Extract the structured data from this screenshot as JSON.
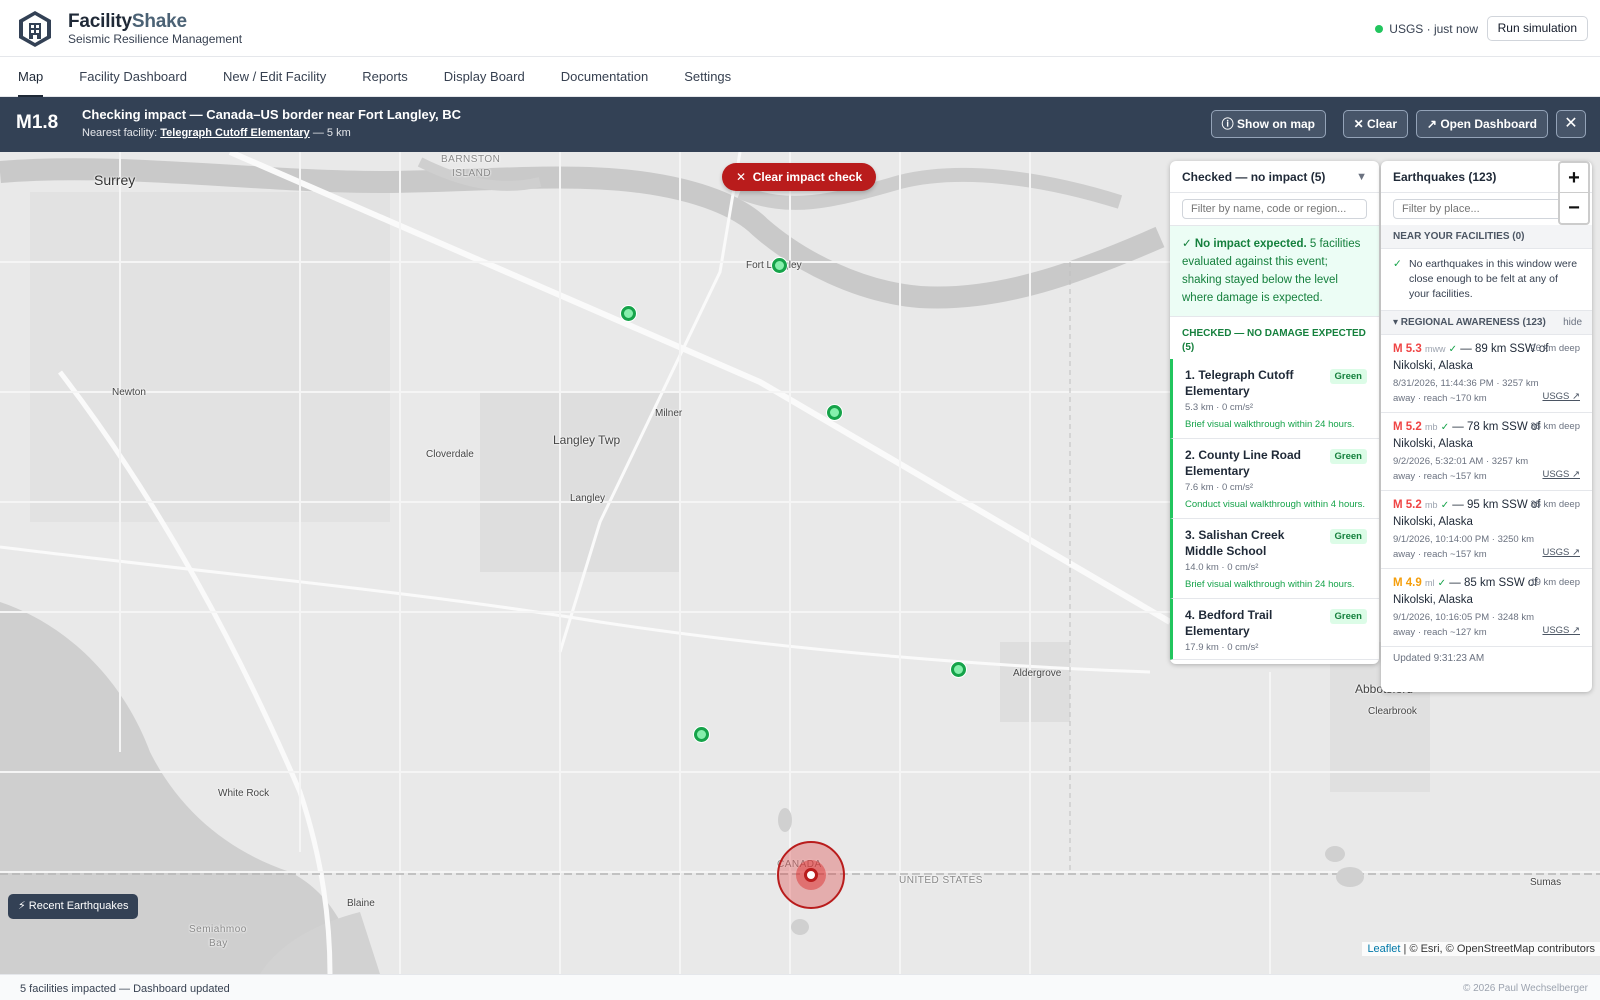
{
  "app": {
    "brand_part1": "Facility",
    "brand_part2": "Shake",
    "tagline": "Seismic Resilience Management",
    "usgs_status": "USGS · just now",
    "run_simulation": "Run simulation"
  },
  "nav": {
    "tabs": [
      "Map",
      "Facility Dashboard",
      "New / Edit Facility",
      "Reports",
      "Display Board",
      "Documentation",
      "Settings"
    ],
    "active": "Map"
  },
  "banner": {
    "magnitude": "M1.8",
    "title": "Checking impact — Canada–US border near Fort Langley, BC",
    "nearest_prefix": "Nearest facility: ",
    "nearest_name": "Telegraph Cutoff Elementary",
    "nearest_suffix": " — 5 km",
    "show_on_map": "Show on map",
    "clear": "Clear",
    "open_dashboard": "Open Dashboard",
    "close": "✕"
  },
  "map": {
    "clear_impact_check": "Clear impact check",
    "recent_earthquakes": "Recent Earthquakes",
    "attribution_leaflet": "Leaflet",
    "attribution_rest": " | © Esri, © OpenStreetMap contributors",
    "places": {
      "surrey": "Surrey",
      "barnston": "BARNSTON",
      "island": "ISLAND",
      "fort_langley": "Fort Langley",
      "newton": "Newton",
      "milner": "Milner",
      "langley_twp": "Langley Twp",
      "cloverdale": "Cloverdale",
      "langley": "Langley",
      "aldergrove": "Aldergrove",
      "abbotsford": "Abbotsford",
      "clearbrook": "Clearbrook",
      "white_rock": "White Rock",
      "blaine": "Blaine",
      "semiahmoo": "Semiahmoo",
      "bay": "Bay",
      "canada": "CANADA",
      "united_states": "UNITED STATES",
      "sumas": "Sumas"
    }
  },
  "facilities_panel": {
    "header": "Checked — no impact (5)",
    "caret": "▼",
    "search_placeholder": "Filter by name, code or region...",
    "no_impact_title": "No impact expected.",
    "no_impact_body": " 5 facilities evaluated against this event; shaking stayed below the level where damage is expected.",
    "checked_header": "CHECKED — NO DAMAGE EXPECTED (5)",
    "items": [
      {
        "name": "1. Telegraph Cutoff Elementary",
        "badge": "Green",
        "meta": "5.3 km · 0 cm/s²",
        "action": "Brief visual walkthrough within 24 hours."
      },
      {
        "name": "2. County Line Road Elementary",
        "badge": "Green",
        "meta": "7.6 km · 0 cm/s²",
        "action": "Conduct visual walkthrough within 4 hours."
      },
      {
        "name": "3. Salishan Creek Middle School",
        "badge": "Green",
        "meta": "14.0 km · 0 cm/s²",
        "action": "Brief visual walkthrough within 24 hours."
      },
      {
        "name": "4. Bedford Trail Elementary",
        "badge": "Green",
        "meta": "17.9 km · 0 cm/s²",
        "action": ""
      }
    ]
  },
  "earthquakes_panel": {
    "header": "Earthquakes (123)",
    "search_placeholder": "Filter by place...",
    "near_header": "NEAR YOUR FACILITIES (0)",
    "near_message": "No earthquakes in this window were close enough to be felt at any of your facilities.",
    "regional_header": "▾  REGIONAL AWARENESS (123)",
    "regional_hide": "hide",
    "items": [
      {
        "mag": "M 5.3",
        "type": "mww",
        "check": "✓",
        "place": "— 89 km SSW of Nikolski, Alaska",
        "depth": "26 km deep",
        "meta": "8/31/2026, 11:44:36 PM · 3257 km away · reach ~170 km",
        "link": "USGS ↗",
        "color": "#ef4444"
      },
      {
        "mag": "M 5.2",
        "type": "mb",
        "check": "✓",
        "place": "— 78 km SSW of Nikolski, Alaska",
        "depth": "35 km deep",
        "meta": "9/2/2026, 5:32:01 AM · 3257 km away · reach ~157 km",
        "link": "USGS ↗",
        "color": "#ef4444"
      },
      {
        "mag": "M 5.2",
        "type": "mb",
        "check": "✓",
        "place": "— 95 km SSW of Nikolski, Alaska",
        "depth": "35 km deep",
        "meta": "9/1/2026, 10:14:00 PM · 3250 km away · reach ~157 km",
        "link": "USGS ↗",
        "color": "#ef4444"
      },
      {
        "mag": "M 4.9",
        "type": "ml",
        "check": "✓",
        "place": "— 85 km SSW of Nikolski, Alaska",
        "depth": "19 km deep",
        "meta": "9/1/2026, 10:16:05 PM · 3248 km away · reach ~127 km",
        "link": "USGS ↗",
        "color": "#f59e0b"
      }
    ],
    "updated": "Updated 9:31:23 AM"
  },
  "zoom": {
    "in": "+",
    "out": "−"
  },
  "footer": {
    "status": "5 facilities impacted — Dashboard updated",
    "copyright": "© 2026 Paul Wechselberger"
  },
  "colors": {
    "banner_bg": "#334155",
    "facility_green": "#16a34a",
    "alert_red": "#b91c1c"
  }
}
